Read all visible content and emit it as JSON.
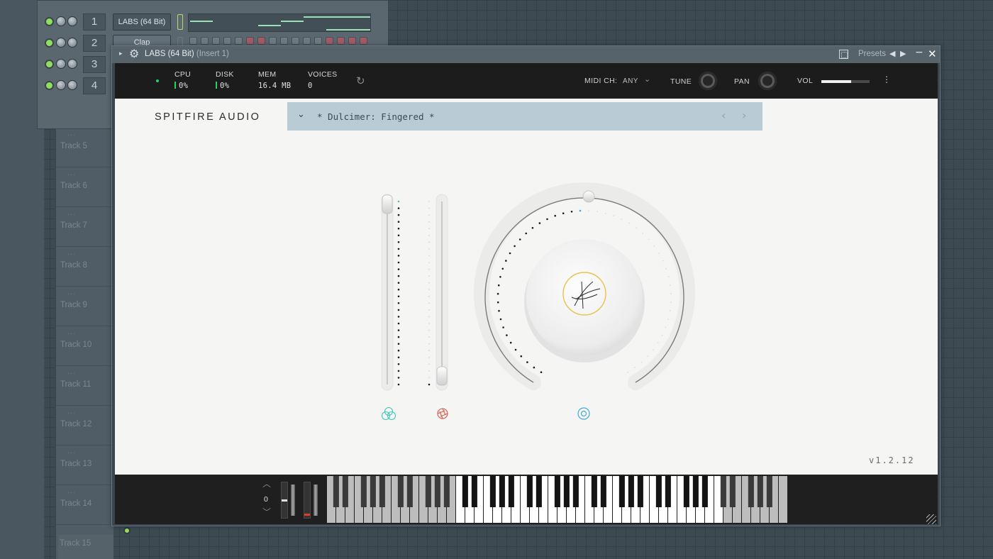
{
  "daw": {
    "tracks": [
      "Track 5",
      "Track 6",
      "Track 7",
      "Track 8",
      "Track 9",
      "Track 10",
      "Track 11",
      "Track 12",
      "Track 13",
      "Track 14",
      "Track 15"
    ],
    "track_dots": "...",
    "channels": [
      {
        "number": "1",
        "name": "LABS (64 Bit)"
      },
      {
        "number": "2",
        "name": "Clap"
      },
      {
        "number": "3",
        "name": ""
      },
      {
        "number": "4",
        "name": ""
      }
    ]
  },
  "window": {
    "title": "LABS (64 Bit)",
    "insert": "(Insert 1)",
    "presets_label": "Presets",
    "arrow_icon": "▸",
    "gear_icon": "⚙",
    "prev_icon": "◀",
    "next_icon": "▶",
    "minimize_icon": "−",
    "close_icon": "✕"
  },
  "status": {
    "cpu_label": "CPU",
    "cpu_value": "0%",
    "disk_label": "DISK",
    "disk_value": "0%",
    "mem_label": "MEM",
    "mem_value": "16.4 MB",
    "voices_label": "VOICES",
    "voices_value": "0",
    "refresh_icon": "↻",
    "midi_label": "MIDI CH:",
    "midi_value": "ANY",
    "midi_chevron": "⌄",
    "tune_label": "TUNE",
    "pan_label": "PAN",
    "vol_label": "VOL",
    "vol_level": 0.62,
    "menu_icon": "⋮"
  },
  "plugin": {
    "brand": "SPITFIRE AUDIO",
    "preset_name": "* Dulcimer: Fingered *",
    "preset_chevron": "⌄",
    "preset_prev": "‹",
    "preset_next": "›",
    "version": "v1.2.12",
    "fader1_level": 1.0,
    "fader2_level": 0.0,
    "dial_level": 0.5,
    "colors": {
      "fader1_icon": "#3fc7b4",
      "fader2_icon": "#e0544a",
      "dial_icon": "#42a9d6",
      "dial_center": "#e8c34a"
    }
  },
  "keyboard": {
    "octave_up": "︿",
    "octave_value": "0",
    "octave_down": "﹀"
  }
}
